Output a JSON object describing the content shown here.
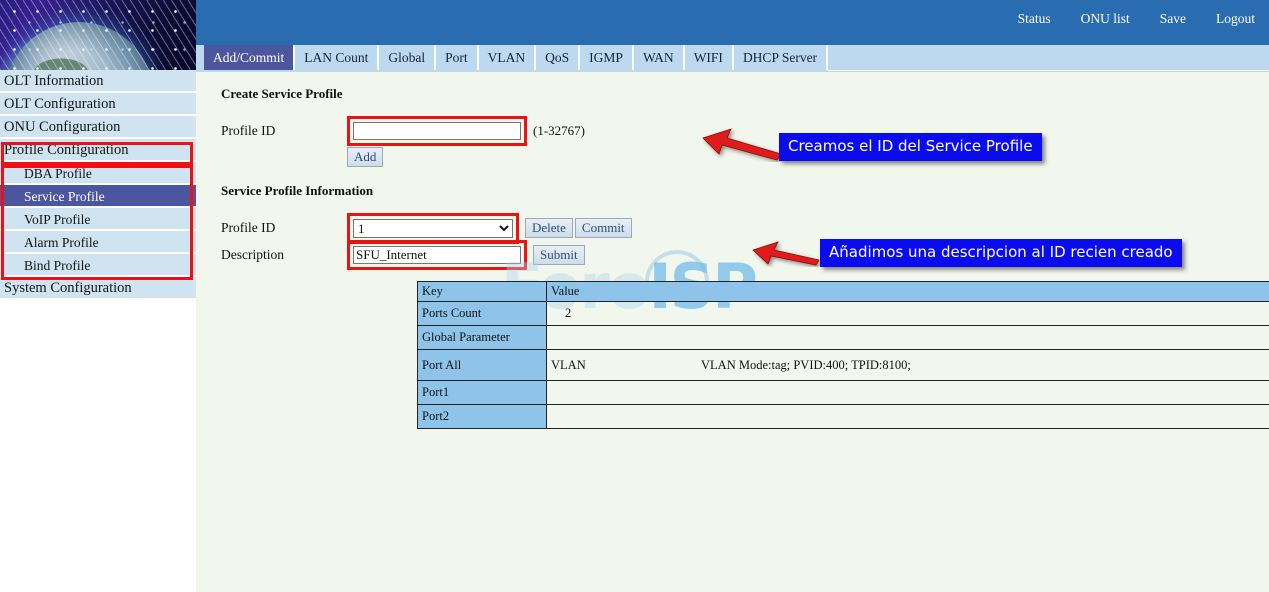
{
  "sidebar": {
    "banner_icon": "globe-fiber-banner",
    "items": [
      {
        "label": "OLT Information",
        "level": 0,
        "active": false
      },
      {
        "label": "OLT Configuration",
        "level": 0,
        "active": false
      },
      {
        "label": "ONU Configuration",
        "level": 0,
        "active": false
      },
      {
        "label": "Profile Configuration",
        "level": 0,
        "active": false
      },
      {
        "label": "DBA Profile",
        "level": 1,
        "active": false
      },
      {
        "label": "Service Profile",
        "level": 1,
        "active": true
      },
      {
        "label": "VoIP Profile",
        "level": 1,
        "active": false
      },
      {
        "label": "Alarm Profile",
        "level": 1,
        "active": false
      },
      {
        "label": "Bind Profile",
        "level": 1,
        "active": false
      },
      {
        "label": "System Configuration",
        "level": 0,
        "active": false
      }
    ]
  },
  "topnav": {
    "links": [
      {
        "label": "Status"
      },
      {
        "label": "ONU list"
      },
      {
        "label": "Save"
      },
      {
        "label": "Logout"
      }
    ]
  },
  "tabs": [
    {
      "label": "Add/Commit",
      "active": true
    },
    {
      "label": "LAN Count",
      "active": false
    },
    {
      "label": "Global",
      "active": false
    },
    {
      "label": "Port",
      "active": false
    },
    {
      "label": "VLAN",
      "active": false
    },
    {
      "label": "QoS",
      "active": false
    },
    {
      "label": "IGMP",
      "active": false
    },
    {
      "label": "WAN",
      "active": false
    },
    {
      "label": "WIFI",
      "active": false
    },
    {
      "label": "DHCP Server",
      "active": false
    }
  ],
  "create_section": {
    "title": "Create Service Profile",
    "profile_id_label": "Profile ID",
    "profile_id_value": "",
    "profile_id_placeholder": "",
    "range_hint": "(1-32767)",
    "add_button": "Add"
  },
  "info_section": {
    "title": "Service Profile Information",
    "profile_id_label": "Profile ID",
    "profile_id_selected": "1",
    "profile_id_options": [
      "1"
    ],
    "delete_button": "Delete",
    "commit_button": "Commit",
    "description_label": "Description",
    "description_value": "SFU_Internet",
    "submit_button": "Submit"
  },
  "table": {
    "headers": [
      "Key",
      "Value"
    ],
    "rows": [
      {
        "key": "Ports Count",
        "value": "2",
        "value2": ""
      },
      {
        "key": "Global Parameter",
        "value": "",
        "value2": ""
      },
      {
        "key": "Port All",
        "value": "VLAN",
        "value2": "VLAN Mode:tag; PVID:400; TPID:8100;"
      },
      {
        "key": "Port1",
        "value": "",
        "value2": ""
      },
      {
        "key": "Port2",
        "value": "",
        "value2": ""
      }
    ]
  },
  "annotations": [
    {
      "text": "Creamos el ID del Service Profile",
      "name": "callout-create-id"
    },
    {
      "text": "Añadimos una descripcion al ID recien creado",
      "name": "callout-add-description"
    }
  ],
  "watermark": {
    "part1": "Foro",
    "part2": "ISP"
  },
  "colors": {
    "accent_blue": "#2a6cb0",
    "tab_active": "#4c569f",
    "annotation_blue": "#0b0bf0",
    "highlight_red": "#ee1111",
    "table_header": "#8fc4ea",
    "page_bg": "#f2f7ee"
  }
}
